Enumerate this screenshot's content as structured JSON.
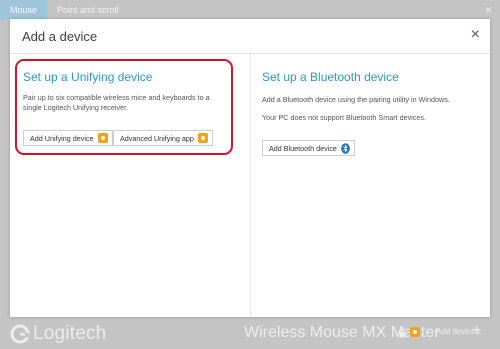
{
  "app": {
    "tabs": [
      "Mouse",
      "Point and scroll"
    ],
    "close_glyph": "×",
    "logo_text": "Logitech",
    "device_name": "Wireless Mouse MX Master",
    "add_devices_label": "Add devices",
    "add_glyph": "+"
  },
  "dialog": {
    "title": "Add a device",
    "close_glyph": "×",
    "unifying": {
      "title": "Set up a Unifying device",
      "description": "Pair up to six compatible wireless mice and keyboards to a single Logitech Unifying receiver.",
      "add_button": "Add Unifying device",
      "advanced_button": "Advanced Unifying app"
    },
    "bluetooth": {
      "title": "Set up a Bluetooth device",
      "description": "Add a Bluetooth device using the pairing utility in Windows.",
      "note": "Your PC does not support Bluetooth Smart devices.",
      "add_button": "Add Bluetooth device"
    }
  },
  "colors": {
    "accent": "#2f9ac1",
    "highlight": "#d2142a",
    "unifying_icon": "#f2a31a",
    "bluetooth_icon": "#1f6fb8"
  },
  "icons": {
    "unifying": "unifying-receiver-icon",
    "bluetooth": "bluetooth-icon"
  }
}
